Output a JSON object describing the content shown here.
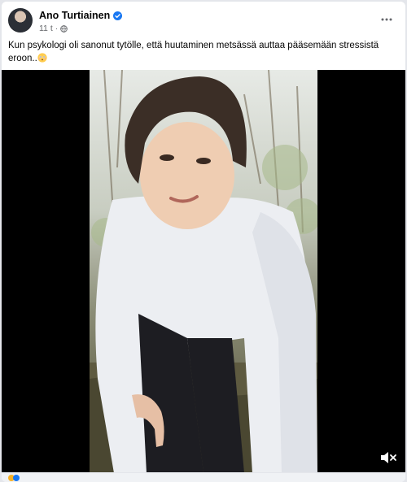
{
  "post": {
    "author": "Ano Turtiainen",
    "time": "11 t",
    "separator": "·",
    "caption": "Kun psykologi oli sanonut tytölle, että huutaminen metsässä auttaa pääsemään stressistä eroon..",
    "more_label": "•••"
  },
  "icons": {
    "verified": "verified-badge-icon",
    "privacy": "globe-icon",
    "more": "more-options-icon",
    "emoji": "flushed-face-emoji",
    "mute": "speaker-muted-icon"
  },
  "colors": {
    "accent": "#1877f2",
    "text": "#050505",
    "meta": "#65676b",
    "video_bg": "#000000"
  }
}
